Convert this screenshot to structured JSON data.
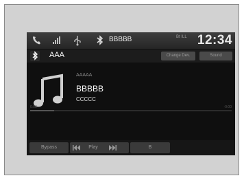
{
  "statusbar": {
    "text": "BBBBB",
    "clock": "12:34",
    "signal": "Bt ILL",
    "icons": [
      "phone-icon",
      "signal-icon",
      "usb-icon",
      "bluetooth-icon"
    ]
  },
  "source": {
    "name": "AAA",
    "icon": "bluetooth-icon",
    "buttons": [
      "Change Dev.",
      "Sound"
    ]
  },
  "track": {
    "artist": "AAAAA",
    "title": "BBBBB",
    "album": "CCCCC",
    "art_icon": "music-note-icon",
    "progress": 0.12,
    "elapsed": "0:00",
    "duration": "-0:00"
  },
  "controls": {
    "left_label": "Bypass",
    "transport_label": "Play",
    "prev_icon": "skip-back-icon",
    "next_icon": "skip-forward-icon",
    "right_label": "B"
  },
  "colors": {
    "screen_bg": "#0f0f0f",
    "status_bg": "#2f2f2f",
    "button_bg": "#3a3a3a",
    "text_primary": "#ffffff",
    "text_secondary": "#8a8a8a"
  }
}
